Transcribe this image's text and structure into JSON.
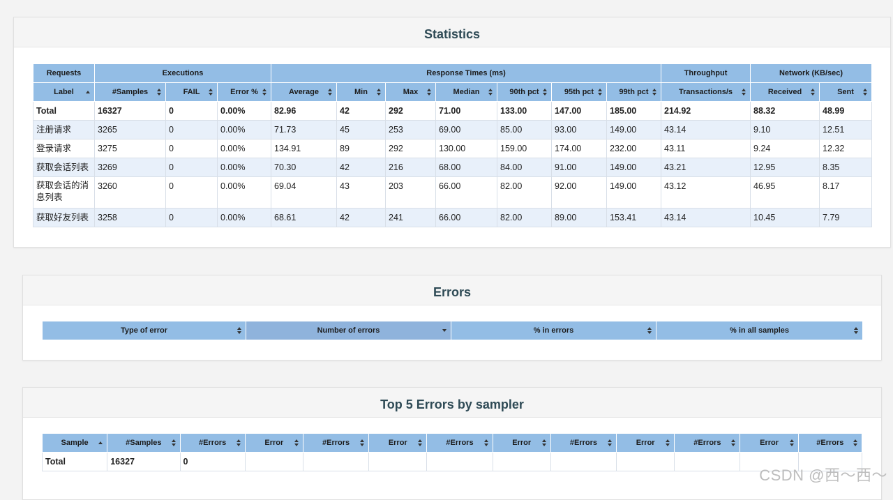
{
  "statistics": {
    "title": "Statistics",
    "group_headers": [
      "Requests",
      "Executions",
      "Response Times (ms)",
      "Throughput",
      "Network (KB/sec)"
    ],
    "columns": [
      "Label",
      "#Samples",
      "FAIL",
      "Error %",
      "Average",
      "Min",
      "Max",
      "Median",
      "90th pct",
      "95th pct",
      "99th pct",
      "Transactions/s",
      "Received",
      "Sent"
    ],
    "total": [
      "Total",
      "16327",
      "0",
      "0.00%",
      "82.96",
      "42",
      "292",
      "71.00",
      "133.00",
      "147.00",
      "185.00",
      "214.92",
      "88.32",
      "48.99"
    ],
    "rows": [
      [
        "注册请求",
        "3265",
        "0",
        "0.00%",
        "71.73",
        "45",
        "253",
        "69.00",
        "85.00",
        "93.00",
        "149.00",
        "43.14",
        "9.10",
        "12.51"
      ],
      [
        "登录请求",
        "3275",
        "0",
        "0.00%",
        "134.91",
        "89",
        "292",
        "130.00",
        "159.00",
        "174.00",
        "232.00",
        "43.11",
        "9.24",
        "12.32"
      ],
      [
        "获取会话列表",
        "3269",
        "0",
        "0.00%",
        "70.30",
        "42",
        "216",
        "68.00",
        "84.00",
        "91.00",
        "149.00",
        "43.21",
        "12.95",
        "8.35"
      ],
      [
        "获取会话的消息列表",
        "3260",
        "0",
        "0.00%",
        "69.04",
        "43",
        "203",
        "66.00",
        "82.00",
        "92.00",
        "149.00",
        "43.12",
        "46.95",
        "8.17"
      ],
      [
        "获取好友列表",
        "3258",
        "0",
        "0.00%",
        "68.61",
        "42",
        "241",
        "66.00",
        "82.00",
        "89.00",
        "153.41",
        "43.14",
        "10.45",
        "7.79"
      ]
    ]
  },
  "errors": {
    "title": "Errors",
    "columns": [
      "Type of error",
      "Number of errors",
      "% in errors",
      "% in all samples"
    ]
  },
  "top5": {
    "title": "Top 5 Errors by sampler",
    "columns": [
      "Sample",
      "#Samples",
      "#Errors",
      "Error",
      "#Errors",
      "Error",
      "#Errors",
      "Error",
      "#Errors",
      "Error",
      "#Errors",
      "Error",
      "#Errors"
    ],
    "total": [
      "Total",
      "16327",
      "0",
      "",
      "",
      "",
      "",
      "",
      "",
      "",
      "",
      "",
      ""
    ]
  },
  "watermark": "CSDN @西～西～"
}
